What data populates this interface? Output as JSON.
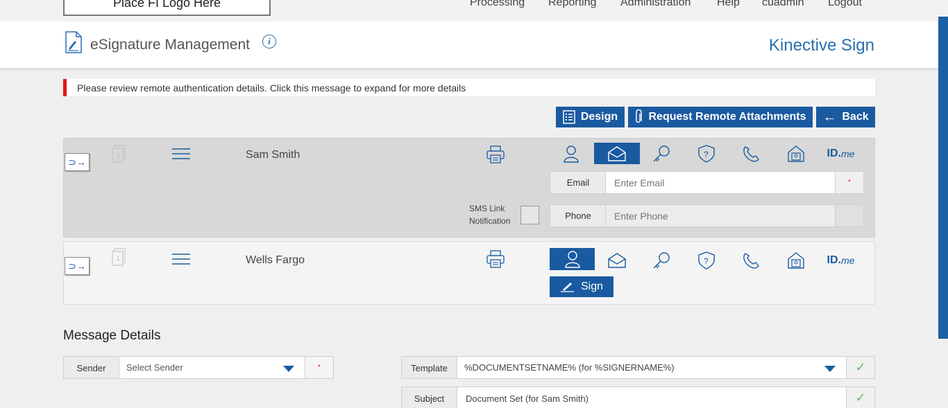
{
  "nav": {
    "logo": "Place FI Logo Here",
    "links": [
      "Processing",
      "Reporting",
      "Administration",
      "Help",
      "cuadmin",
      "Logout"
    ]
  },
  "header": {
    "title": "eSignature Management",
    "brand": "Kinective Sign"
  },
  "alert": {
    "text": "Please review remote authentication details. Click this message to expand for more details"
  },
  "actions": {
    "design": "Design",
    "attachments": "Request Remote Attachments",
    "back": "Back"
  },
  "signers": [
    {
      "name": "Sam Smith",
      "page_count": "1",
      "email_label": "Email",
      "email_placeholder": "Enter Email",
      "email_required": "*",
      "phone_label": "Phone",
      "phone_placeholder": "Enter Phone",
      "sms_label_1": "SMS Link",
      "sms_label_2": "Notification",
      "active_auth": "email"
    },
    {
      "name": "Wells Fargo",
      "page_count": "1",
      "active_auth": "in-person",
      "sign_label": "Sign"
    }
  ],
  "auth_methods": [
    "in-person-icon",
    "email-icon",
    "key-icon",
    "security-question-icon",
    "phone-icon",
    "id-verification-icon",
    "idme-icon"
  ],
  "idme": {
    "id": "ID.",
    "me": "me"
  },
  "message_details": {
    "title": "Message Details",
    "sender_label": "Sender",
    "sender_placeholder": "Select Sender",
    "sender_required": "*",
    "template_label": "Template",
    "template_value": "%DOCUMENTSETNAME% (for %SIGNERNAME%)",
    "subject_label": "Subject",
    "subject_value": "Document Set (for Sam Smith)",
    "check": "✓"
  },
  "colors": {
    "primary": "#1a5aa0",
    "alert": "#e0161f",
    "brand": "#2a6fb0"
  }
}
